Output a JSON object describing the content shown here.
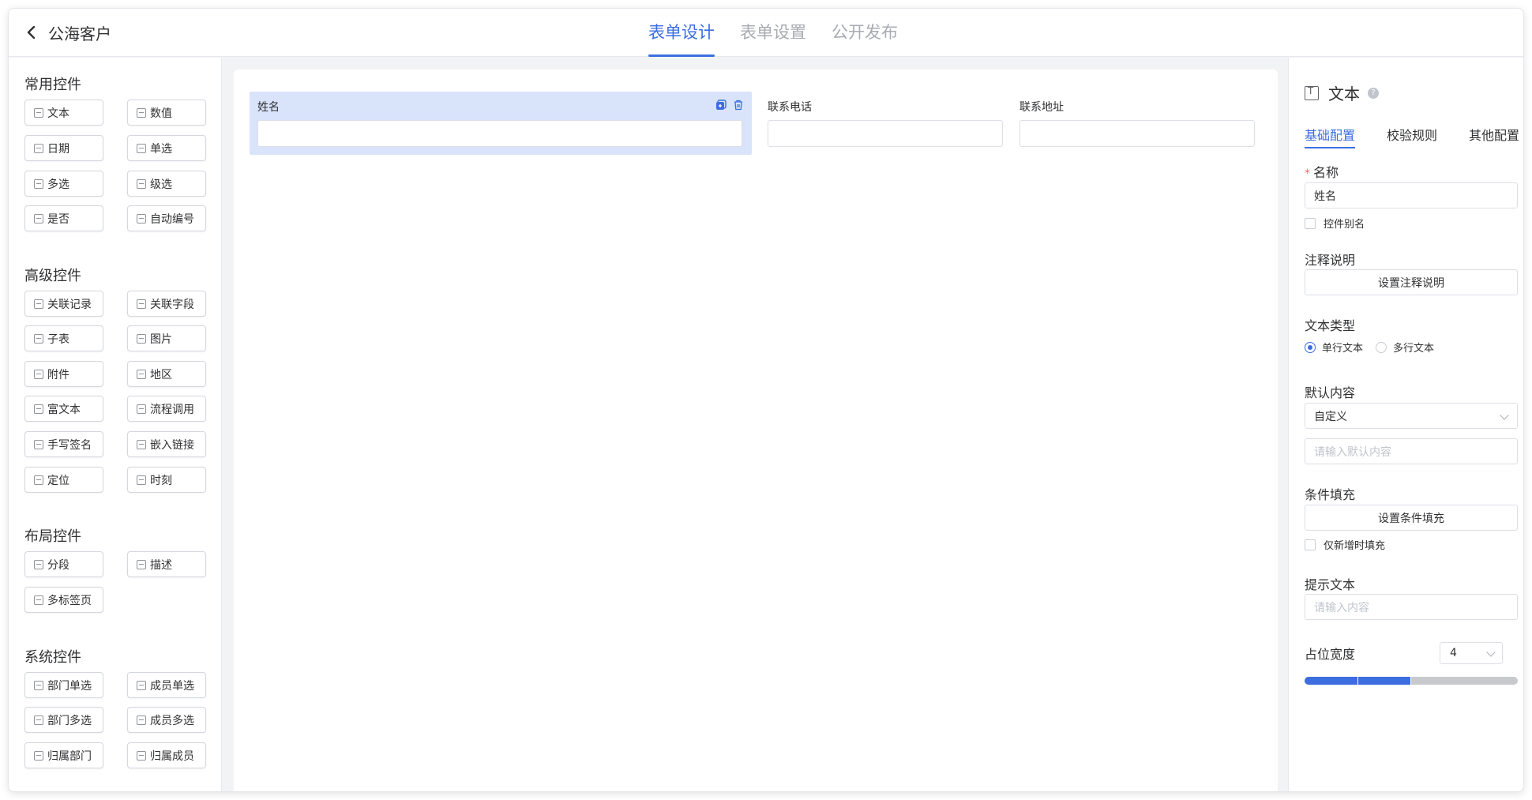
{
  "header": {
    "back_title": "公海客户",
    "tabs": [
      {
        "label": "表单设计",
        "active": true
      },
      {
        "label": "表单设置",
        "active": false
      },
      {
        "label": "公开发布",
        "active": false
      }
    ]
  },
  "palette": {
    "common": {
      "title": "常用控件",
      "items": [
        "文本",
        "数值",
        "日期",
        "单选",
        "多选",
        "级选",
        "是否",
        "自动编号"
      ]
    },
    "advanced": {
      "title": "高级控件",
      "items": [
        "关联记录",
        "关联字段",
        "子表",
        "图片",
        "附件",
        "地区",
        "富文本",
        "流程调用",
        "手写签名",
        "嵌入链接",
        "定位",
        "时刻"
      ]
    },
    "layout": {
      "title": "布局控件",
      "items": [
        "分段",
        "描述",
        "多标签页"
      ]
    },
    "system": {
      "title": "系统控件",
      "items": [
        "部门单选",
        "成员单选",
        "部门多选",
        "成员多选",
        "归属部门",
        "归属成员"
      ]
    }
  },
  "canvas": {
    "fields": [
      {
        "label": "姓名",
        "selected": true
      },
      {
        "label": "联系电话",
        "selected": false
      },
      {
        "label": "联系地址",
        "selected": false
      }
    ]
  },
  "panel": {
    "title": "文本",
    "tabs": [
      "基础配置",
      "校验规则",
      "其他配置"
    ],
    "name_label": "名称",
    "name_value": "姓名",
    "alias_label": "控件别名",
    "note_label": "注释说明",
    "note_button": "设置注释说明",
    "text_type_label": "文本类型",
    "text_type_options": [
      "单行文本",
      "多行文本"
    ],
    "text_type_selected": "单行文本",
    "default_label": "默认内容",
    "default_select": "自定义",
    "default_placeholder": "请输入默认内容",
    "cond_label": "条件填充",
    "cond_button": "设置条件填充",
    "cond_check": "仅新增时填充",
    "hint_label": "提示文本",
    "hint_placeholder": "请输入内容",
    "width_label": "占位宽度",
    "width_value": "4",
    "width_fraction": 0.5,
    "accent": "#3c6ee0"
  }
}
